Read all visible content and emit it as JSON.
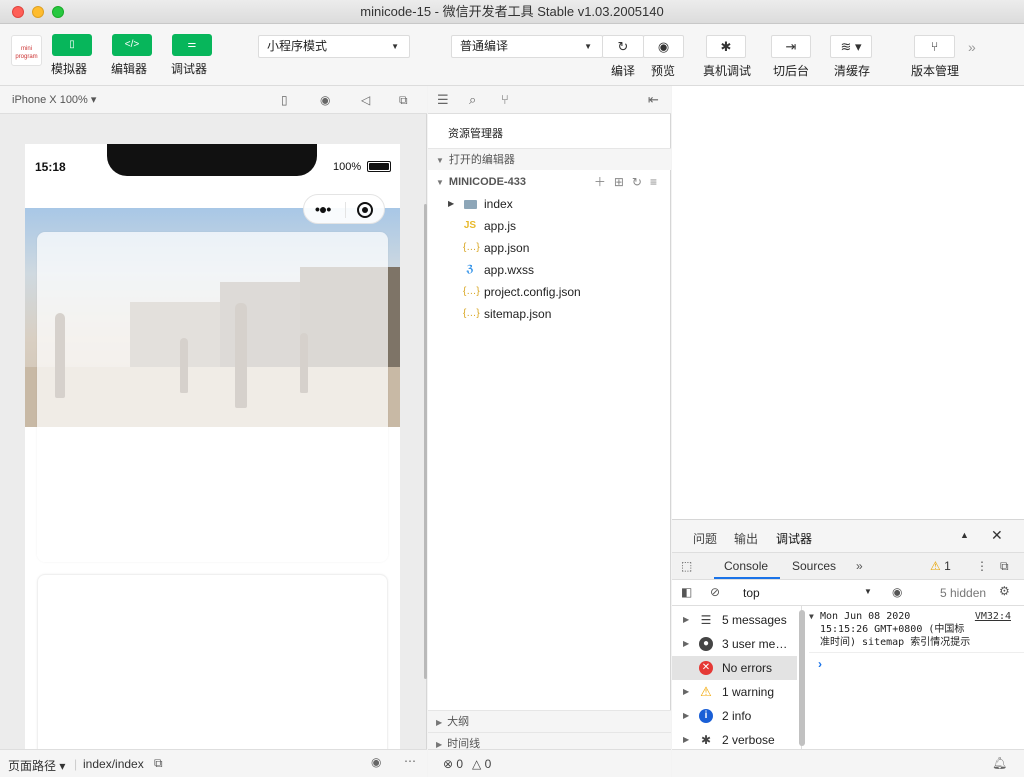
{
  "window": {
    "title": "minicode-15 - 微信开发者工具 Stable v1.03.2005140"
  },
  "toolbar": {
    "logo_text": "mini program",
    "simulator_label": "模拟器",
    "editor_label": "编辑器",
    "debugger_label": "调试器",
    "mode_select": "小程序模式",
    "compile_select": "普通编译",
    "compile_label": "编译",
    "preview_label": "预览",
    "remote_debug_label": "真机调试",
    "background_label": "切后台",
    "clear_cache_label": "清缓存",
    "version_label": "版本管理"
  },
  "simulator": {
    "device": "iPhone X 100%",
    "time": "15:18",
    "battery": "100%",
    "footer": {
      "path_label": "页面路径",
      "path_value": "index/index"
    }
  },
  "explorer": {
    "title": "资源管理器",
    "open_editors": "打开的编辑器",
    "project": "MINICODE-433",
    "files": [
      {
        "name": "index",
        "type": "folder"
      },
      {
        "name": "app.js",
        "type": "js"
      },
      {
        "name": "app.json",
        "type": "json"
      },
      {
        "name": "app.wxss",
        "type": "wxss"
      },
      {
        "name": "project.config.json",
        "type": "json"
      },
      {
        "name": "sitemap.json",
        "type": "json"
      }
    ],
    "outline": "大纲",
    "timeline": "时间线",
    "footer": {
      "errors": "0",
      "warnings": "0"
    }
  },
  "devtools": {
    "tabs": [
      "问题",
      "输出",
      "调试器"
    ],
    "console_tabs": [
      "Console",
      "Sources"
    ],
    "warning_count": "1",
    "context": "top",
    "hidden": "5 hidden",
    "sidebar": [
      {
        "label": "5 messages",
        "icon": "list-icon"
      },
      {
        "label": "3 user me…",
        "icon": "user-icon"
      },
      {
        "label": "No errors",
        "icon": "error-icon"
      },
      {
        "label": "1 warning",
        "icon": "warning-icon"
      },
      {
        "label": "2 info",
        "icon": "info-icon"
      },
      {
        "label": "2 verbose",
        "icon": "verbose-icon"
      }
    ],
    "log": {
      "line1": "Mon Jun 08 2020",
      "source": "VM32:4",
      "line2": "15:15:26 GMT+0800 (中国标",
      "line3": "准时间) sitemap 索引情况提示"
    }
  }
}
